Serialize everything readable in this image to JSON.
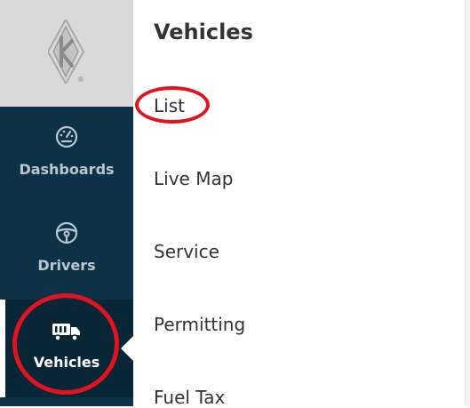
{
  "logo": {
    "name": "k-logo-icon",
    "mark": "®"
  },
  "nav": {
    "items": [
      {
        "label": "Dashboards",
        "icon": "speedometer-icon"
      },
      {
        "label": "Drivers",
        "icon": "steering-wheel-icon"
      },
      {
        "label": "Vehicles",
        "icon": "truck-icon",
        "active": true
      }
    ]
  },
  "submenu": {
    "title": "Vehicles",
    "items": [
      {
        "label": "List"
      },
      {
        "label": "Live Map"
      },
      {
        "label": "Service"
      },
      {
        "label": "Permitting"
      },
      {
        "label": "Fuel Tax"
      }
    ]
  },
  "colors": {
    "rail": "#0d3248",
    "rail_active": "#082636",
    "logo_bg": "#d9d9d9",
    "annotation": "#e0131f",
    "text": "#333333"
  }
}
